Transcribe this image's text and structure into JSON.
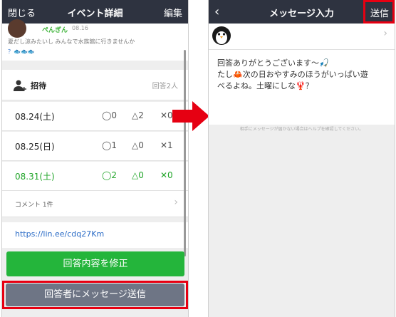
{
  "left_screen": {
    "navbar": {
      "close": "閉じる",
      "title": "イベント詳細",
      "edit": "編集"
    },
    "post": {
      "poster": "ぺんぎん",
      "date": "08.16",
      "text": "夏だし涼みたいし みんなで水族館に行きませんか",
      "emoji_line": "？🐟🐟🐟"
    },
    "invite": {
      "label": "招待",
      "count": "回答2人"
    },
    "rows": [
      {
        "date": "08.24(土)",
        "circle": "◯0",
        "triangle": "△2",
        "cross": "✕0"
      },
      {
        "date": "08.25(日)",
        "circle": "◯1",
        "triangle": "△0",
        "cross": "✕1"
      },
      {
        "date": "08.31(土)",
        "circle": "◯2",
        "triangle": "△0",
        "cross": "✕0"
      }
    ],
    "comment": {
      "label": "コメント 1件",
      "chevron": "›"
    },
    "link": "https://lin.ee/cdq27Km",
    "modify_button": "回答内容を修正",
    "message_button": "回答者にメッセージ送信"
  },
  "right_screen": {
    "navbar": {
      "back": "‹",
      "title": "メッセージ入力",
      "send": "送信"
    },
    "recipient": {
      "chevron": "›"
    },
    "message_lines": [
      "回答ありがとうございます〜🎣",
      "たし🦀次の日おやすみのほうがいっぱい遊",
      "べるよね。土曜にしな🦞？"
    ],
    "help": "相手にメッセージが届かない場合はヘルプを確認してください。"
  },
  "colors": {
    "navbar": "#2e3340",
    "green": "#24b53b",
    "gray_button": "#6e7585",
    "highlight": "#e60012",
    "arrow": "#e60012"
  }
}
